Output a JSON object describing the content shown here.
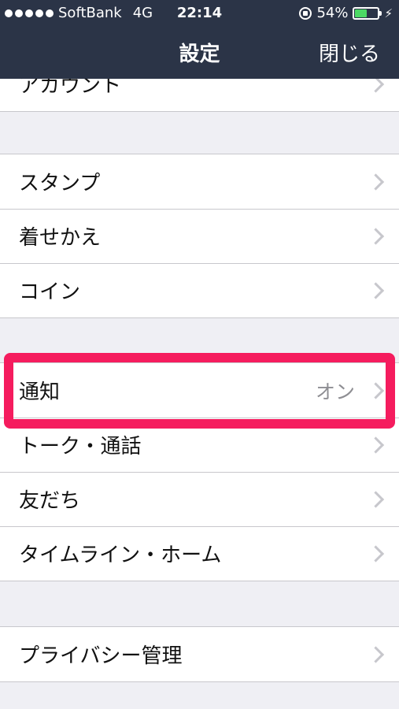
{
  "status_bar": {
    "carrier": "SoftBank",
    "network": "4G",
    "time": "22:14",
    "battery_percent": "54%",
    "battery_level": 0.54
  },
  "nav": {
    "title": "設定",
    "close_label": "閉じる"
  },
  "groups": [
    {
      "items": [
        {
          "label": "アカウント"
        }
      ]
    },
    {
      "items": [
        {
          "label": "スタンプ"
        },
        {
          "label": "着せかえ"
        },
        {
          "label": "コイン"
        }
      ]
    },
    {
      "items": [
        {
          "label": "通知",
          "value": "オン"
        },
        {
          "label": "トーク・通話"
        },
        {
          "label": "友だち"
        },
        {
          "label": "タイムライン・ホーム"
        }
      ]
    },
    {
      "items": [
        {
          "label": "プライバシー管理"
        }
      ]
    }
  ],
  "highlight_color": "#f51c5e",
  "header_color": "#2b3447"
}
